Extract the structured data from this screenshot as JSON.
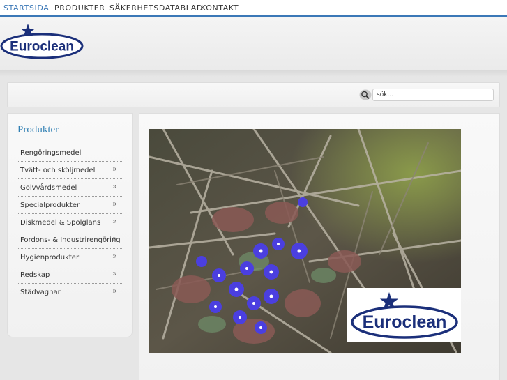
{
  "nav": {
    "items": [
      {
        "label": "STARTSIDA",
        "active": true
      },
      {
        "label": "PRODUKTER",
        "active": false
      },
      {
        "label": "SÄKERHETSDATABLAD",
        "active": false
      },
      {
        "label": "KONTAKT",
        "active": false
      }
    ]
  },
  "brand": {
    "logo_text": "Euroclean",
    "color": "#1b2f7a"
  },
  "search": {
    "placeholder": "sök...",
    "icon": "magnifier-icon"
  },
  "sidebar": {
    "title": "Produkter",
    "items": [
      {
        "label": "Rengöringsmedel",
        "has_submenu": false
      },
      {
        "label": "Tvätt- och sköljmedel",
        "has_submenu": true
      },
      {
        "label": "Golvvårdsmedel",
        "has_submenu": true
      },
      {
        "label": "Specialprodukter",
        "has_submenu": true
      },
      {
        "label": "Diskmedel & Spolglans",
        "has_submenu": true
      },
      {
        "label": "Fordons- & Industrirengöring",
        "has_submenu": true
      },
      {
        "label": "Hygienprodukter",
        "has_submenu": true
      },
      {
        "label": "Redskap",
        "has_submenu": true
      },
      {
        "label": "Städvagnar",
        "has_submenu": true
      }
    ],
    "arrow_glyph": "»"
  },
  "colors": {
    "accent": "#3b78b7",
    "sidebar_title": "#2f7fb3"
  }
}
